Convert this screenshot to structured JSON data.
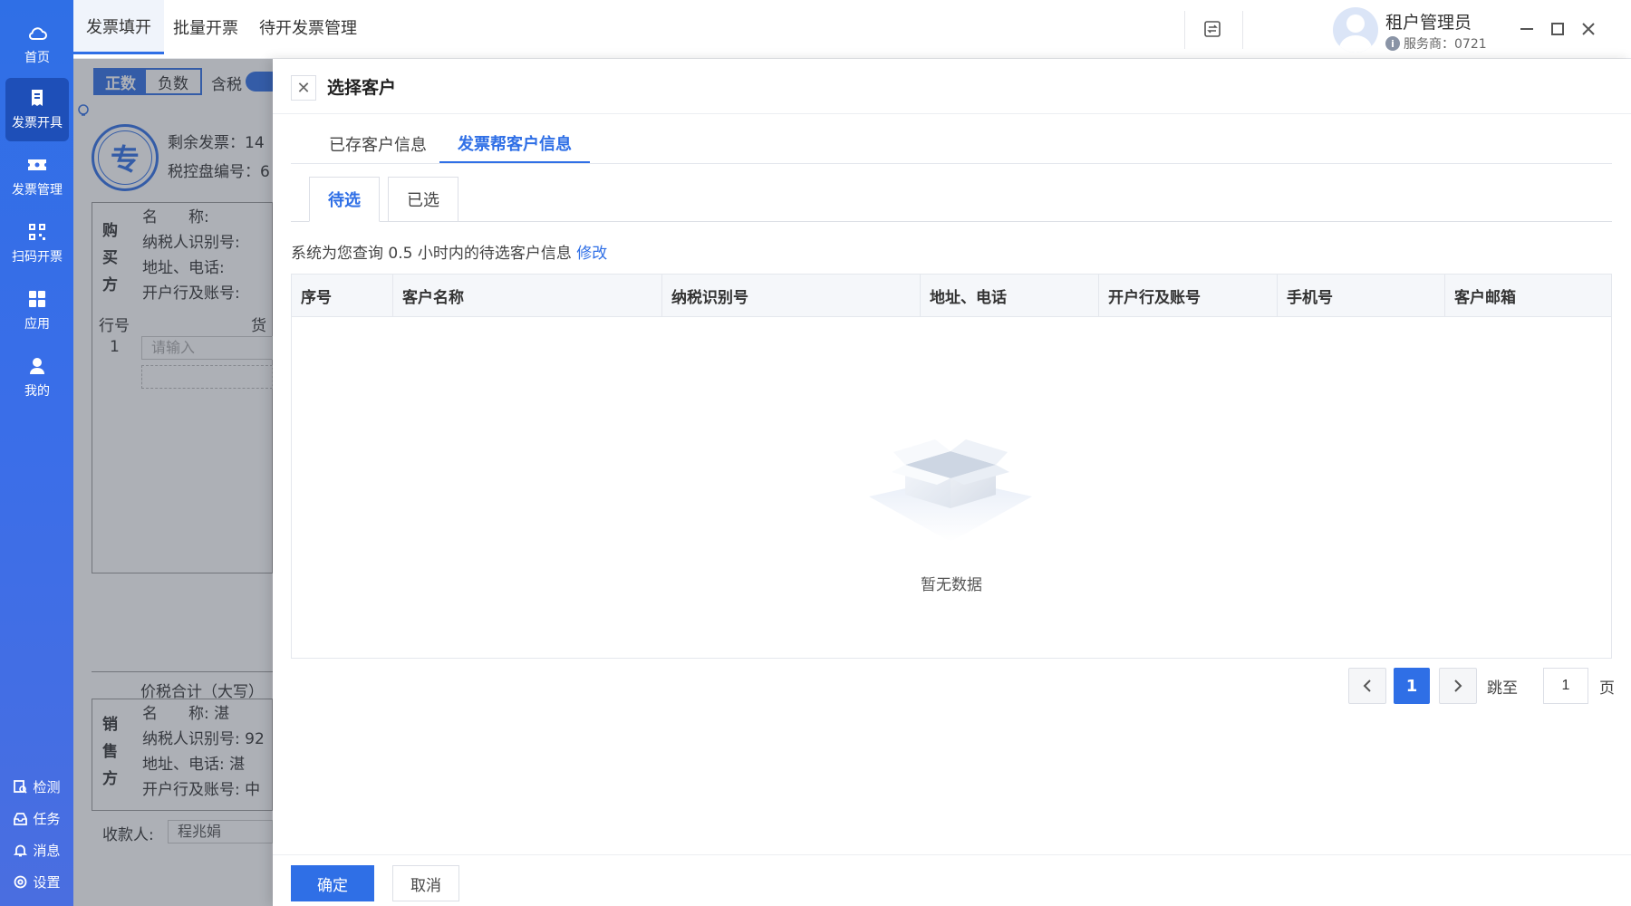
{
  "sidebar": {
    "items": [
      {
        "label": "首页",
        "icon": "cloud-icon"
      },
      {
        "label": "发票开具",
        "icon": "invoice-icon"
      },
      {
        "label": "发票管理",
        "icon": "ticket-icon"
      },
      {
        "label": "扫码开票",
        "icon": "qrcode-icon"
      },
      {
        "label": "应用",
        "icon": "apps-icon"
      },
      {
        "label": "我的",
        "icon": "user-icon"
      }
    ],
    "bottom": [
      {
        "label": "检测",
        "icon": "detect-icon"
      },
      {
        "label": "任务",
        "icon": "task-icon"
      },
      {
        "label": "消息",
        "icon": "bell-icon"
      },
      {
        "label": "设置",
        "icon": "settings-icon"
      }
    ]
  },
  "topbar": {
    "tabs": [
      "发票填开",
      "批量开票",
      "待开发票管理"
    ],
    "user_name": "租户管理员",
    "user_sub": "服务商：0721"
  },
  "bgform": {
    "toggle_pos": "正数",
    "toggle_neg": "负数",
    "tax_incl": "含税",
    "badge": "专",
    "remaining": "剩余发票：14",
    "disk_no": "税控盘编号：6",
    "buyer": "购买方",
    "f_name": "名　　称:",
    "f_taxid": "纳税人识别号:",
    "f_addr": "地址、电话:",
    "f_bank": "开户行及账号:",
    "line_no": "行号",
    "goods": "货",
    "row1": "1",
    "input_ph": "请输入",
    "total": "价税合计（大写）",
    "seller": "销售方",
    "s_name": "名　　称: 湛",
    "s_taxid": "纳税人识别号: 92",
    "s_addr": "地址、电话: 湛",
    "s_bank": "开户行及账号: 中",
    "payee": "收款人:",
    "payee_name": "程兆娟"
  },
  "drawer": {
    "title": "选择客户",
    "tabs": [
      "已存客户信息",
      "发票帮客户信息"
    ],
    "sub_tabs": [
      "待选",
      "已选"
    ],
    "query_note": "系统为您查询 0.5 小时内的待选客户信息",
    "modify": "修改",
    "columns": [
      "序号",
      "客户名称",
      "纳税识别号",
      "地址、电话",
      "开户行及账号",
      "手机号",
      "客户邮箱"
    ],
    "empty": "暂无数据",
    "pager": {
      "current": "1",
      "jump_label": "跳至",
      "jump_value": "1",
      "page_unit": "页"
    },
    "ok": "确定",
    "cancel": "取消"
  },
  "colors": {
    "primary": "#2f6fe6",
    "sidebar": "#3b6ee8",
    "active_side": "#1e4fb8"
  }
}
